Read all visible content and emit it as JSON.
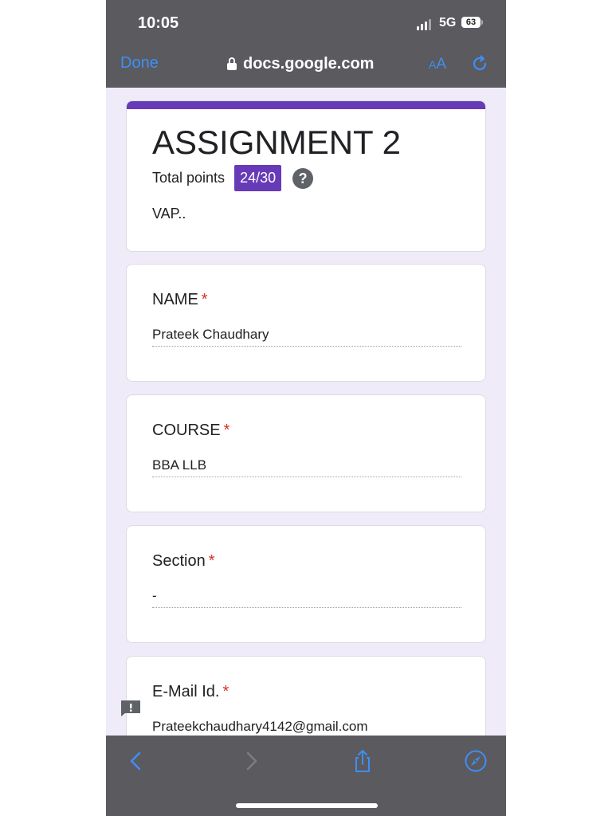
{
  "status": {
    "time": "10:05",
    "network": "5G",
    "battery": "63"
  },
  "browser": {
    "done_label": "Done",
    "url": "docs.google.com",
    "text_size_small": "A",
    "text_size_large": "A"
  },
  "form": {
    "title": "ASSIGNMENT 2",
    "total_points_label": "Total points",
    "score": "24/30",
    "help_symbol": "?",
    "description": "VAP..",
    "accent_color": "#673ab7"
  },
  "questions": [
    {
      "label": "NAME",
      "required_mark": "*",
      "answer": "Prateek Chaudhary"
    },
    {
      "label": "COURSE",
      "required_mark": "*",
      "answer": "BBA LLB"
    },
    {
      "label": "Section",
      "required_mark": "*",
      "answer": "-"
    },
    {
      "label": "E-Mail Id.",
      "required_mark": "*",
      "answer": "Prateekchaudhary4142@gmail.com"
    }
  ],
  "icons": [
    "lock-icon",
    "reload-icon",
    "feedback-icon",
    "back-icon",
    "forward-icon",
    "share-icon",
    "compass-icon"
  ]
}
